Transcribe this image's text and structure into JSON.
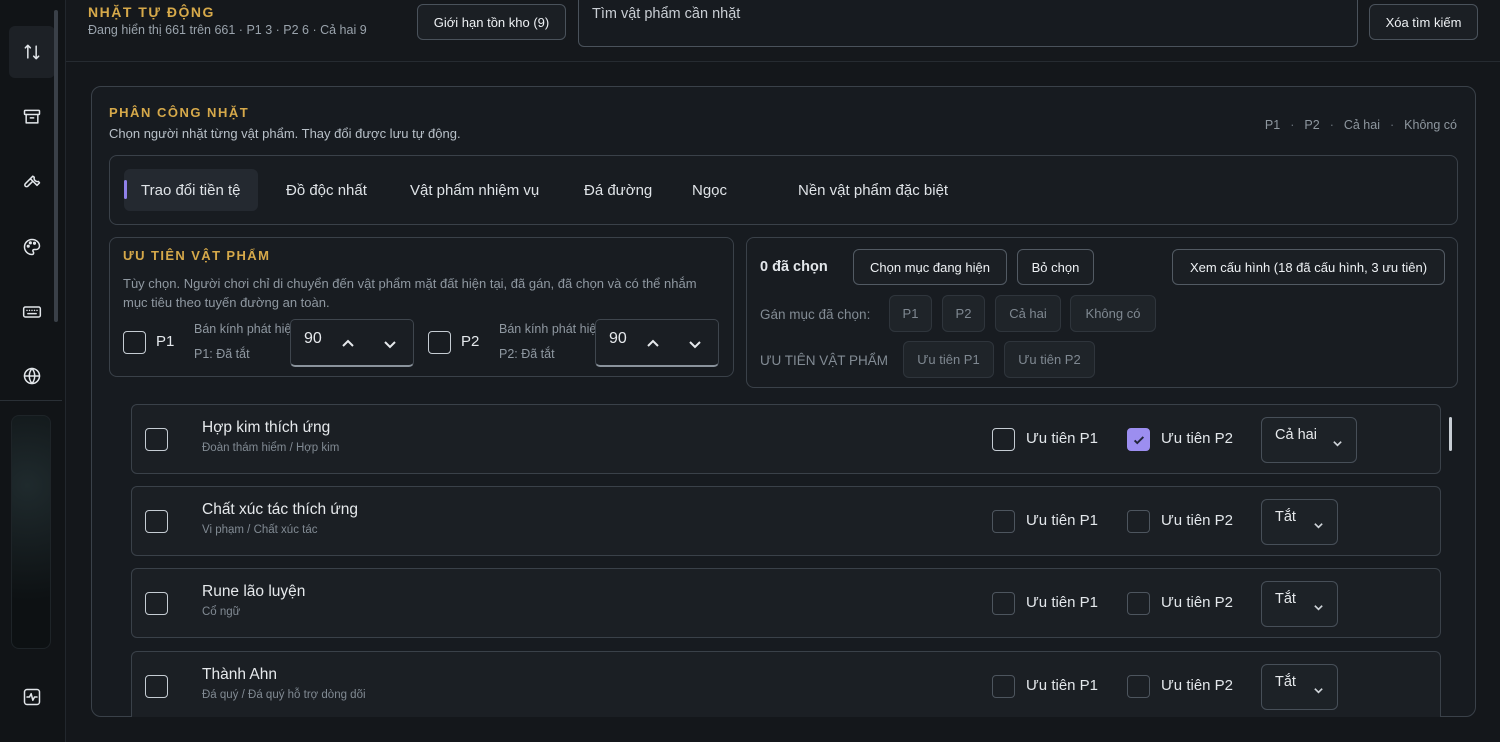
{
  "header": {
    "title": "NHẶT TỰ ĐỘNG",
    "subtitle": "Đang hiển thị 661 trên 661 · P1 3 · P2 6 · Cả hai 9",
    "stock_limit_button": "Giới hạn tồn kho (9)",
    "search_placeholder": "Tìm vật phẩm cần nhặt",
    "clear_search_button": "Xóa tìm kiếm"
  },
  "rail": {
    "icons": [
      "swap-vertical-icon",
      "archive-icon",
      "wrench-icon",
      "palette-icon",
      "keyboard-icon",
      "globe-icon",
      "activity-icon"
    ]
  },
  "panel": {
    "title": "PHÂN CÔNG NHẶT",
    "subtitle": "Chọn người nhặt từng vật phẩm. Thay đổi được lưu tự động.",
    "legend": [
      "P1",
      "P2",
      "Cả hai",
      "Không có"
    ],
    "legend_sep": "·"
  },
  "tabs": [
    {
      "label": "Trao đổi tiền tệ",
      "active": true
    },
    {
      "label": "Đồ độc nhất"
    },
    {
      "label": "Vật phẩm nhiệm vụ"
    },
    {
      "label": "Đá đường"
    },
    {
      "label": "Ngọc"
    },
    {
      "label": "Nền vật phẩm đặc biệt"
    }
  ],
  "priority": {
    "title": "ƯU TIÊN VẬT PHẨM",
    "description": "Tùy chọn. Người chơi chỉ di chuyển đến vật phẩm mặt đất hiện tại, đã gán, đã chọn và có thể nhắm mục tiêu theo tuyến đường an toàn.",
    "p1": {
      "label": "P1",
      "radius_label": "Bán kính phát hiện, đơn vị",
      "status": "P1: Đã tắt",
      "radius": "90"
    },
    "p2": {
      "label": "P2",
      "radius_label": "Bán kính phát hiện, đơn vị",
      "status": "P2: Đã tắt",
      "radius": "90"
    }
  },
  "selection": {
    "count_label": "0 đã chọn",
    "select_visible_button": "Chọn mục đang hiện",
    "deselect_button": "Bỏ chọn",
    "view_config_button": "Xem cấu hình (18 đã cấu hình, 3 ưu tiên)",
    "assign_label": "Gán mục đã chọn:",
    "assign_options": [
      "P1",
      "P2",
      "Cả hai",
      "Không có"
    ],
    "priority_label": "ƯU TIÊN VẬT PHẨM",
    "priority_options": [
      "Ưu tiên P1",
      "Ưu tiên P2"
    ]
  },
  "items": [
    {
      "name": "Hợp kim thích ứng",
      "path": "Đoàn thám hiểm / Hợp kim",
      "p1_label": "Ưu tiên P1",
      "p1_checked": false,
      "p2_label": "Ưu tiên P2",
      "p2_checked": true,
      "assignment": "Cả hai"
    },
    {
      "name": "Chất xúc tác thích ứng",
      "path": "Vi phạm / Chất xúc tác",
      "p1_label": "Ưu tiên P1",
      "p1_checked": false,
      "p2_label": "Ưu tiên P2",
      "p2_checked": false,
      "assignment": "Tắt"
    },
    {
      "name": "Rune lão luyện",
      "path": "Cổ ngữ",
      "p1_label": "Ưu tiên P1",
      "p1_checked": false,
      "p2_label": "Ưu tiên P2",
      "p2_checked": false,
      "assignment": "Tắt"
    },
    {
      "name": "Thành Ahn",
      "path": "Đá quý / Đá quý hỗ trợ dòng dõi",
      "p1_label": "Ưu tiên P1",
      "p1_checked": false,
      "p2_label": "Ưu tiên P2",
      "p2_checked": false,
      "assignment": "Tắt"
    }
  ],
  "colors": {
    "accent_gold": "#d6a94a",
    "accent_purple": "#9c8ef0",
    "background": "#14171b"
  }
}
